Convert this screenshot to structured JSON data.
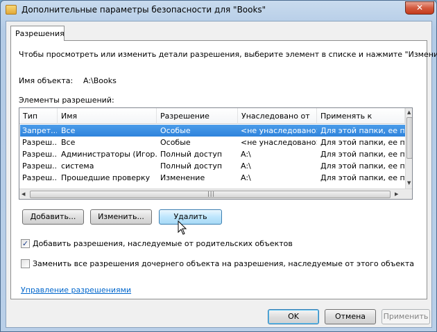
{
  "window": {
    "title": "Дополнительные параметры безопасности  для \"Books\"",
    "close_glyph": "✕"
  },
  "tab": {
    "label": "Разрешения"
  },
  "intro_text": "Чтобы просмотреть или изменить детали разрешения, выберите элемент в списке и нажмите \"Изменить\".",
  "object": {
    "label": "Имя объекта:",
    "value": "A:\\Books"
  },
  "list_label": "Элементы разрешений:",
  "columns": [
    "Тип",
    "Имя",
    "Разрешение",
    "Унаследовано от",
    "Применять к"
  ],
  "rows": [
    {
      "type": "Запрет...",
      "name": "Все",
      "permission": "Особые",
      "inherited": "<не унаследовано>",
      "applies": "Для этой папки, ее под...",
      "selected": true
    },
    {
      "type": "Разреш...",
      "name": "Все",
      "permission": "Особые",
      "inherited": "<не унаследовано>",
      "applies": "Для этой папки, ее под...",
      "selected": false
    },
    {
      "type": "Разреш...",
      "name": "Администраторы (Игор...",
      "permission": "Полный доступ",
      "inherited": "A:\\",
      "applies": "Для этой папки, ее под...",
      "selected": false
    },
    {
      "type": "Разреш...",
      "name": "система",
      "permission": "Полный доступ",
      "inherited": "A:\\",
      "applies": "Для этой папки, ее под...",
      "selected": false
    },
    {
      "type": "Разреш...",
      "name": "Прошедшие проверку",
      "permission": "Изменение",
      "inherited": "A:\\",
      "applies": "Для этой папки, ее под...",
      "selected": false
    }
  ],
  "buttons": {
    "add": "Добавить...",
    "edit": "Изменить...",
    "delete": "Удалить",
    "ok": "OK",
    "cancel": "Отмена",
    "apply": "Применить"
  },
  "checkboxes": {
    "inherit": {
      "label": "Добавить разрешения, наследуемые от родительских объектов",
      "checked": true
    },
    "replace": {
      "label": "Заменить все разрешения дочернего объекта на разрешения, наследуемые от этого объекта",
      "checked": false
    }
  },
  "manage_link": "Управление разрешениями",
  "colors": {
    "selection": "#3a8fe2",
    "link": "#0066cc",
    "accent_border": "#3c7fb1"
  }
}
